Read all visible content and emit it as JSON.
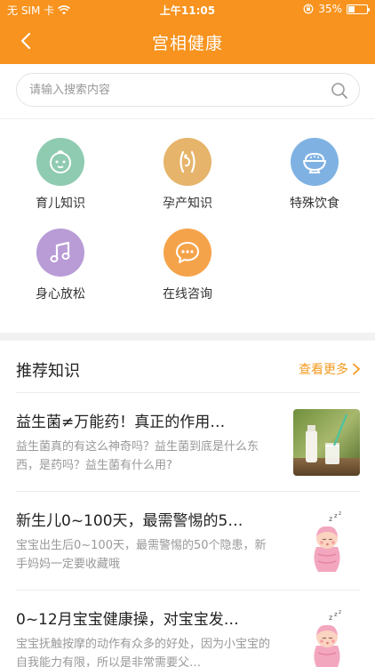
{
  "status_bar": {
    "carrier": "无 SIM 卡",
    "time": "上午11:05",
    "battery": "35%",
    "battery_level": 0.35
  },
  "header": {
    "title": "宫相健康"
  },
  "search": {
    "placeholder": "请输入搜索内容"
  },
  "categories": [
    {
      "label": "育儿知识",
      "icon": "baby-face-icon",
      "color": "#8fcbb1"
    },
    {
      "label": "孕产知识",
      "icon": "pregnancy-icon",
      "color": "#e6b46a"
    },
    {
      "label": "特殊饮食",
      "icon": "rice-bowl-icon",
      "color": "#7fb2e3"
    },
    {
      "label": "身心放松",
      "icon": "music-note-icon",
      "color": "#b99bd6"
    },
    {
      "label": "在线咨询",
      "icon": "chat-bubble-icon",
      "color": "#f5a34a"
    }
  ],
  "recommended": {
    "title": "推荐知识",
    "more": "查看更多",
    "articles": [
      {
        "title": "益生菌≠万能药！真正的作用…",
        "desc": "益生菌真的有这么神奇吗？益生菌到底是什么东西，是药吗？益生菌有什么用?",
        "thumb": "milk-photo"
      },
      {
        "title": "新生儿0~100天，最需警惕的5…",
        "desc": "宝宝出生后0~100天，最需警惕的50个隐患，新手妈妈一定要收藏哦",
        "thumb": "sleeping-baby"
      },
      {
        "title": "0~12月宝宝健康操，对宝宝发…",
        "desc": "宝宝抚触按摩的动作有众多的好处，因为小宝宝的自我能力有限，所以是非常需要父…",
        "thumb": "sleeping-baby"
      }
    ]
  },
  "colors": {
    "brand": "#f7931e",
    "more_link": "#f39a1f"
  }
}
